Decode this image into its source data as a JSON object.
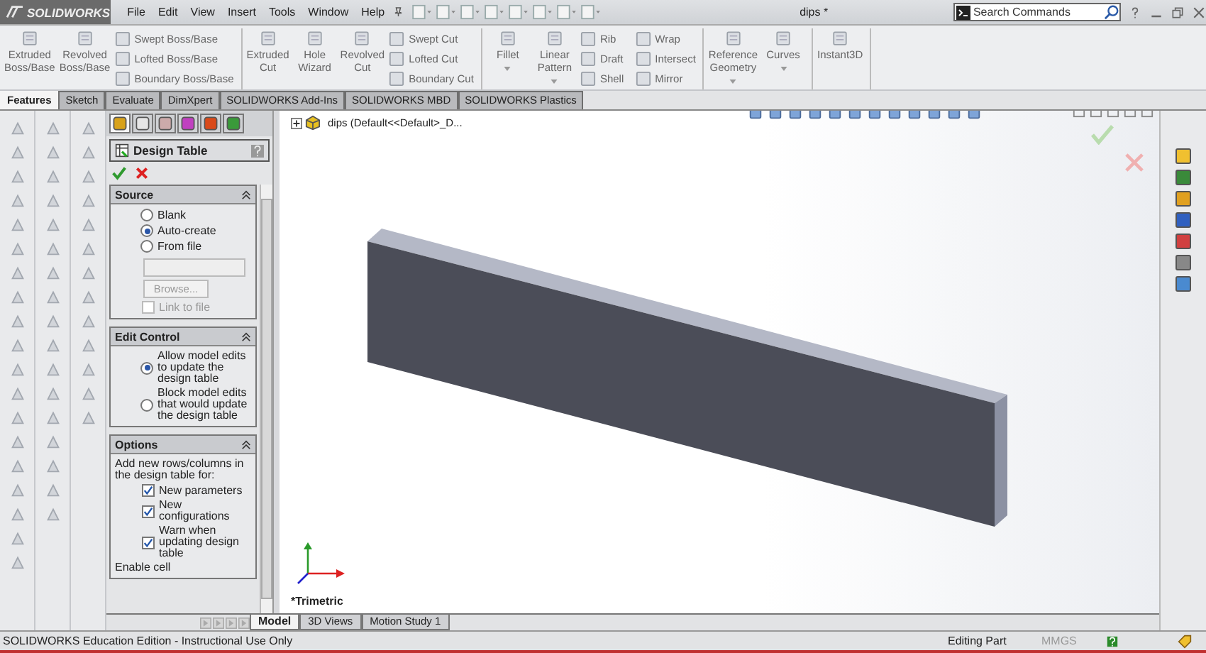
{
  "title_bar": {
    "logo": "SOLIDWORKS",
    "menu": [
      "File",
      "Edit",
      "View",
      "Insert",
      "Tools",
      "Window",
      "Help"
    ],
    "document_title": "dips *",
    "search": {
      "placeholder": "Search Commands"
    }
  },
  "ribbon": {
    "groups": [
      {
        "large": [
          {
            "label": "Extruded\nBoss/Base",
            "dropdown": false
          },
          {
            "label": "Revolved\nBoss/Base",
            "dropdown": false
          }
        ],
        "small": [
          "Swept Boss/Base",
          "Lofted Boss/Base",
          "Boundary Boss/Base"
        ]
      },
      {
        "large": [
          {
            "label": "Extruded\nCut",
            "dropdown": false
          },
          {
            "label": "Hole\nWizard",
            "dropdown": false
          },
          {
            "label": "Revolved\nCut",
            "dropdown": false
          }
        ],
        "small": [
          "Swept Cut",
          "Lofted Cut",
          "Boundary Cut"
        ]
      },
      {
        "large": [
          {
            "label": "Fillet",
            "dropdown": true
          },
          {
            "label": "Linear\nPattern",
            "dropdown": true
          }
        ],
        "small": [
          "Rib",
          "Draft",
          "Shell",
          "Wrap",
          "Intersect",
          "Mirror"
        ]
      },
      {
        "large": [
          {
            "label": "Reference\nGeometry",
            "dropdown": true
          },
          {
            "label": "Curves",
            "dropdown": true
          }
        ]
      },
      {
        "large": [
          {
            "label": "Instant3D",
            "dropdown": false
          }
        ]
      }
    ]
  },
  "tabs": [
    {
      "label": "Features",
      "selected": true
    },
    {
      "label": "Sketch",
      "selected": false
    },
    {
      "label": "Evaluate",
      "selected": false
    },
    {
      "label": "DimXpert",
      "selected": false
    },
    {
      "label": "SOLIDWORKS Add-Ins",
      "selected": false
    },
    {
      "label": "SOLIDWORKS MBD",
      "selected": false
    },
    {
      "label": "SOLIDWORKS Plastics",
      "selected": false
    }
  ],
  "property_manager": {
    "title": "Design Table",
    "sections": [
      {
        "title": "Source",
        "items": [
          {
            "kind": "radio",
            "label": "Blank",
            "selected": false
          },
          {
            "kind": "radio",
            "label": "Auto-create",
            "selected": true
          },
          {
            "kind": "radio",
            "label": "From file",
            "selected": false
          },
          {
            "kind": "field",
            "disabled": true
          },
          {
            "kind": "button",
            "label": "Browse...",
            "disabled": true
          },
          {
            "kind": "checkbox",
            "label": "Link to file",
            "checked": false,
            "disabled": true
          }
        ]
      },
      {
        "title": "Edit Control",
        "items": [
          {
            "kind": "radio",
            "label": "Allow model edits to update the design table",
            "selected": true
          },
          {
            "kind": "radio",
            "label": "Block model edits that would update the design table",
            "selected": false
          }
        ]
      },
      {
        "title": "Options",
        "items": [
          {
            "kind": "text",
            "label": "Add new rows/columns in the design table for:"
          },
          {
            "kind": "checkbox",
            "label": "New parameters",
            "checked": true,
            "disabled": false
          },
          {
            "kind": "checkbox",
            "label": "New configurations",
            "checked": true,
            "disabled": false
          },
          {
            "kind": "checkbox",
            "label": "Warn when updating design table",
            "checked": true,
            "disabled": false
          },
          {
            "kind": "text",
            "label": "Enable cell"
          }
        ]
      }
    ]
  },
  "feature_tree": {
    "root": "dips  (Default<<Default>_D..."
  },
  "view_label": "*Trimetric",
  "bottom_tabs": [
    {
      "label": "Model",
      "selected": true
    },
    {
      "label": "3D Views",
      "selected": false
    },
    {
      "label": "Motion Study 1",
      "selected": false
    }
  ],
  "status_bar": {
    "edition": "SOLIDWORKS Education Edition - Instructional Use Only",
    "mode": "Editing Part",
    "units": "MMGS"
  }
}
